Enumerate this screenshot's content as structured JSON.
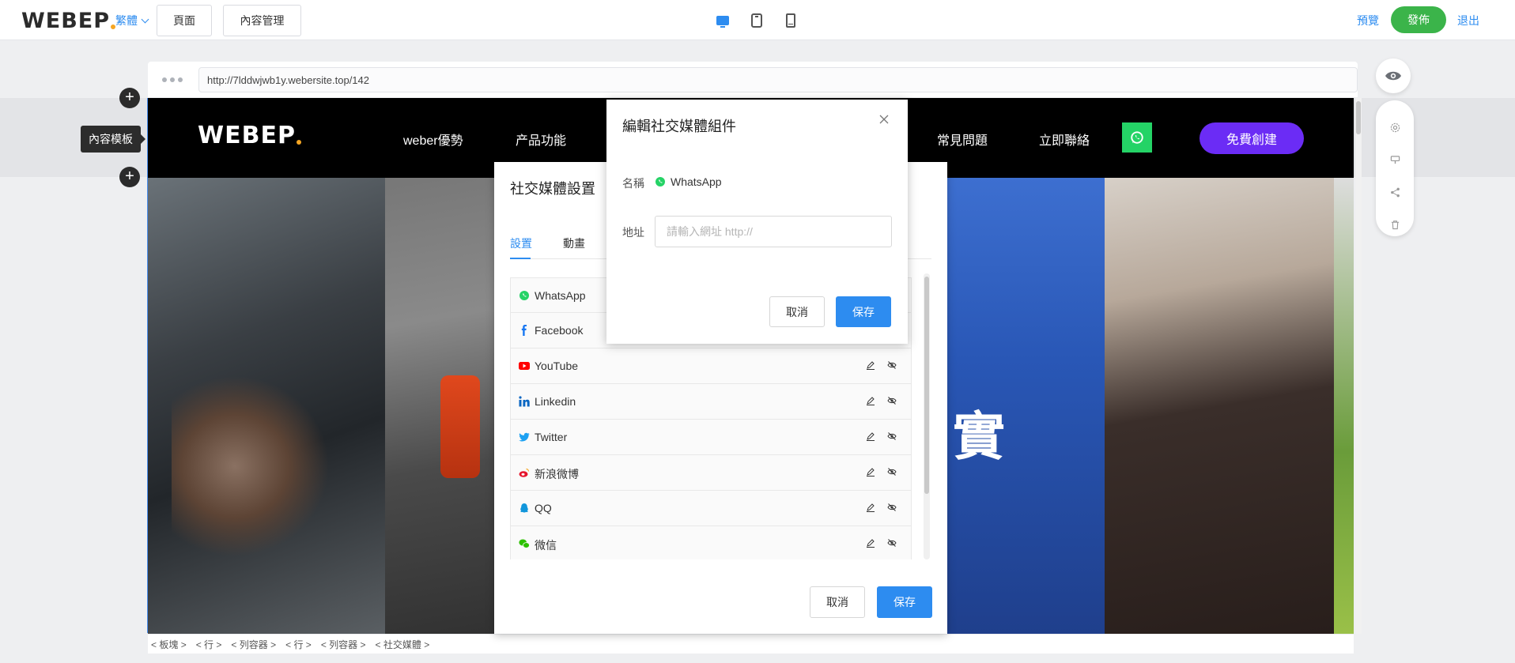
{
  "app": {
    "logo_text": "WEBEP",
    "language": "繁體",
    "pages_button": "頁面",
    "content_button": "內容管理",
    "preview": "預覽",
    "publish": "發佈",
    "exit": "退出",
    "accent_color": "#2d8cf0",
    "publish_color": "#3bb44a"
  },
  "browser": {
    "url": "http://7lddwjwb1y.webersite.top/142"
  },
  "tooltip": "內容模板",
  "site": {
    "logo_text": "WEBEP",
    "nav": [
      "weber優勢",
      "产品功能",
      "常見問題",
      "立即聯絡"
    ],
    "cta": "免費創建",
    "cta_color": "#6b2cf5",
    "hero_char": "實"
  },
  "settings": {
    "title": "社交媒體設置",
    "tabs": [
      "設置",
      "動畫"
    ],
    "active_tab": "設置",
    "items": [
      {
        "name": "WhatsApp",
        "icon": "whatsapp-icon"
      },
      {
        "name": "Facebook",
        "icon": "facebook-icon"
      },
      {
        "name": "YouTube",
        "icon": "youtube-icon"
      },
      {
        "name": "Linkedin",
        "icon": "linkedin-icon"
      },
      {
        "name": "Twitter",
        "icon": "twitter-icon"
      },
      {
        "name": "新浪微博",
        "icon": "weibo-icon"
      },
      {
        "name": "QQ",
        "icon": "qq-icon"
      },
      {
        "name": "微信",
        "icon": "wechat-icon"
      }
    ],
    "cancel": "取消",
    "save": "保存"
  },
  "edit_dialog": {
    "title": "編輯社交媒體組件",
    "name_label": "名稱",
    "name_value": "WhatsApp",
    "address_label": "地址",
    "address_value": "",
    "address_placeholder": "請輸入網址 http://",
    "cancel": "取消",
    "save": "保存"
  },
  "breadcrumb": [
    "板塊",
    "行",
    "列容器",
    "行",
    "列容器",
    "社交媒體"
  ]
}
